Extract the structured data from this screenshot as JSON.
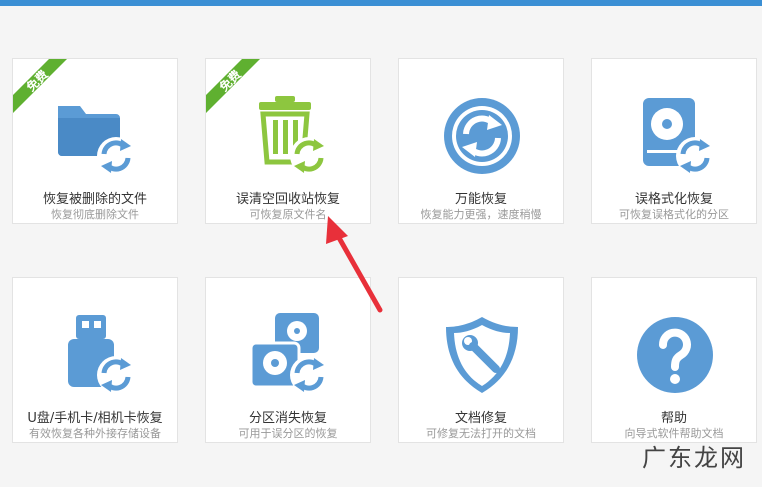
{
  "colors": {
    "accent": "#3b8fd4",
    "icon_blue": "#5b9bd5",
    "icon_green": "#8dc63f",
    "ribbon": "#5fb030",
    "arrow": "#e8303a"
  },
  "badge": "免费",
  "cards": [
    {
      "title": "恢复被删除的文件",
      "subtitle": "恢复彻底删除文件",
      "icon": "folder-restore-icon"
    },
    {
      "title": "误清空回收站恢复",
      "subtitle": "可恢复原文件名",
      "icon": "recycle-bin-restore-icon"
    },
    {
      "title": "万能恢复",
      "subtitle": "恢复能力更强，速度稍慢",
      "icon": "universal-restore-icon"
    },
    {
      "title": "误格式化恢复",
      "subtitle": "可恢复误格式化的分区",
      "icon": "formatted-disk-restore-icon"
    },
    {
      "title": "U盘/手机卡/相机卡恢复",
      "subtitle": "有效恢复各种外接存储设备",
      "icon": "usb-restore-icon"
    },
    {
      "title": "分区消失恢复",
      "subtitle": "可用于误分区的恢复",
      "icon": "partition-restore-icon"
    },
    {
      "title": "文档修复",
      "subtitle": "可修复无法打开的文档",
      "icon": "document-repair-shield-icon"
    },
    {
      "title": "帮助",
      "subtitle": "向导式软件帮助文档",
      "icon": "help-icon"
    }
  ],
  "watermark": "广东龙网"
}
